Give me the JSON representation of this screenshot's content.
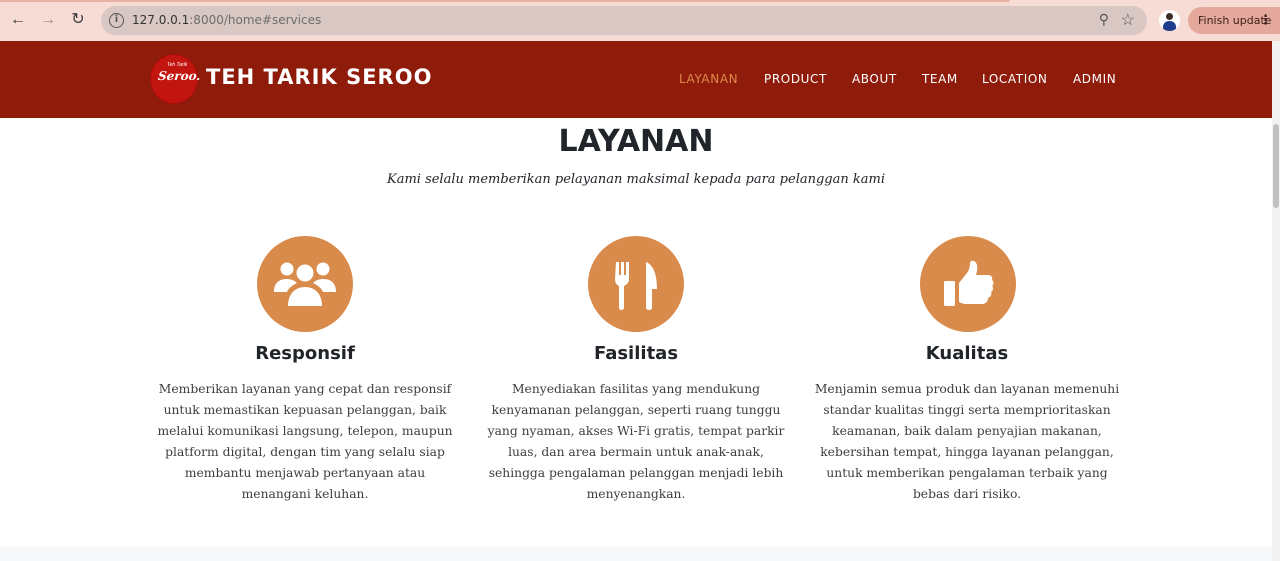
{
  "browser": {
    "url_host": "127.0.0.1",
    "url_rest": ":8000/home#services",
    "update_button": "Finish update",
    "back_icon": "arrow-left-icon",
    "forward_icon": "arrow-right-icon",
    "reload_icon": "reload-icon"
  },
  "header": {
    "brand": "TEH TARIK SEROO",
    "logo_text": "Seroo.",
    "logo_small": "Teh Tarik",
    "menu": [
      {
        "label": "LAYANAN",
        "active": true
      },
      {
        "label": "PRODUCT",
        "active": false
      },
      {
        "label": "ABOUT",
        "active": false
      },
      {
        "label": "TEAM",
        "active": false
      },
      {
        "label": "LOCATION",
        "active": false
      },
      {
        "label": "ADMIN",
        "active": false
      }
    ]
  },
  "services": {
    "title": "LAYANAN",
    "subtitle": "Kami selalu memberikan pelayanan maksimal kepada para pelanggan kami",
    "items": [
      {
        "icon": "users-icon",
        "title": "Responsif",
        "text": "Memberikan layanan yang cepat dan responsif untuk memastikan kepuasan pelanggan, baik melalui komunikasi langsung, telepon, maupun platform digital, dengan tim yang selalu siap membantu menjawab pertanyaan atau menangani keluhan."
      },
      {
        "icon": "utensils-icon",
        "title": "Fasilitas",
        "text": "Menyediakan fasilitas yang mendukung kenyamanan pelanggan, seperti ruang tunggu yang nyaman, akses Wi-Fi gratis, tempat parkir luas, dan area bermain untuk anak-anak, sehingga pengalaman pelanggan menjadi lebih menyenangkan."
      },
      {
        "icon": "thumbs-up-icon",
        "title": "Kualitas",
        "text": "Menjamin semua produk dan layanan memenuhi standar kualitas tinggi serta memprioritaskan keamanan, baik dalam penyajian makanan, kebersihan tempat, hingga layanan pelanggan, untuk memberikan pengalaman terbaik yang bebas dari risiko."
      }
    ]
  },
  "colors": {
    "header_bg": "#8f1b0b",
    "accent": "#d98b4b",
    "active_menu": "#e08a47"
  }
}
